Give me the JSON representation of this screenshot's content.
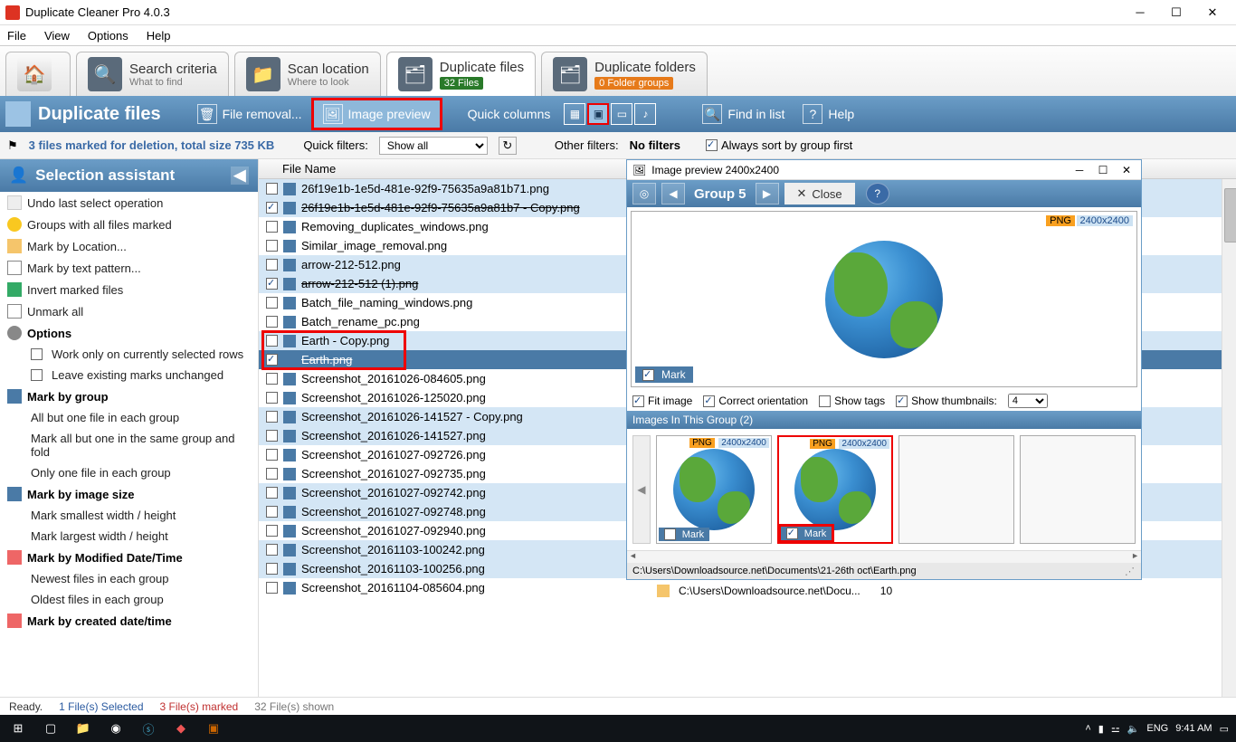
{
  "titlebar": {
    "title": "Duplicate Cleaner Pro 4.0.3"
  },
  "menubar": [
    "File",
    "View",
    "Options",
    "Help"
  ],
  "tabs": {
    "home": "",
    "search": {
      "title": "Search criteria",
      "sub": "What to find"
    },
    "scan": {
      "title": "Scan location",
      "sub": "Where to look"
    },
    "dup_files": {
      "title": "Duplicate files",
      "badge": "32 Files"
    },
    "dup_folders": {
      "title": "Duplicate folders",
      "badge": "0 Folder groups"
    }
  },
  "toolbar": {
    "header": "Duplicate files",
    "file_removal": "File removal...",
    "image_preview": "Image preview",
    "quick_columns": "Quick columns",
    "find_in_list": "Find in list",
    "help": "Help"
  },
  "filterbar": {
    "status": "3 files marked for deletion, total size 735 KB",
    "quick_label": "Quick filters:",
    "quick_value": "Show all",
    "other_label": "Other filters:",
    "other_value": "No filters",
    "always_sort": "Always sort by group first"
  },
  "sidebar": {
    "title": "Selection assistant",
    "items": [
      {
        "ic": "ic-undo",
        "t": "Undo last select operation",
        "bold": false
      },
      {
        "ic": "ic-warn",
        "t": "Groups with all files marked",
        "bold": false
      },
      {
        "ic": "ic-folder",
        "t": "Mark by Location...",
        "bold": false
      },
      {
        "ic": "ic-ab",
        "t": "Mark by text pattern...",
        "bold": false
      },
      {
        "ic": "ic-invert",
        "t": "Invert marked files",
        "bold": false
      },
      {
        "ic": "ic-unmark",
        "t": "Unmark all",
        "bold": false
      },
      {
        "ic": "ic-gear",
        "t": "Options",
        "bold": true
      },
      {
        "sub": true,
        "chk": false,
        "t": "Work only on currently selected rows"
      },
      {
        "sub": true,
        "chk": false,
        "t": "Leave existing marks unchanged"
      },
      {
        "ic": "ic-group",
        "t": "Mark by group",
        "bold": true
      },
      {
        "sub": true,
        "t": "All but one file in each group"
      },
      {
        "sub": true,
        "t": "Mark all but one in the same group and fold"
      },
      {
        "sub": true,
        "t": "Only one file in each group"
      },
      {
        "ic": "ic-image",
        "t": "Mark by image size",
        "bold": true
      },
      {
        "sub": true,
        "t": "Mark smallest width / height"
      },
      {
        "sub": true,
        "t": "Mark largest width / height"
      },
      {
        "ic": "ic-date",
        "t": "Mark by Modified Date/Time",
        "bold": true
      },
      {
        "sub": true,
        "t": "Newest files in each group"
      },
      {
        "sub": true,
        "t": "Oldest files in each group"
      },
      {
        "ic": "ic-date",
        "t": "Mark by created date/time",
        "bold": true
      }
    ]
  },
  "columns": {
    "filename": "File Name"
  },
  "files": [
    {
      "g": 1,
      "chk": false,
      "n": "26f19e1b-1e5d-481e-92f9-75635a9a81b71.png"
    },
    {
      "g": 1,
      "chk": true,
      "strike": true,
      "n": "26f19e1b-1e5d-481e-92f9-75635a9a81b7 - Copy.png"
    },
    {
      "g": 0,
      "chk": false,
      "n": "Removing_duplicates_windows.png"
    },
    {
      "g": 0,
      "chk": false,
      "n": "Similar_image_removal.png"
    },
    {
      "g": 1,
      "chk": false,
      "n": "arrow-212-512.png"
    },
    {
      "g": 1,
      "chk": true,
      "strike": true,
      "n": "arrow-212-512 (1).png"
    },
    {
      "g": 0,
      "chk": false,
      "n": "Batch_file_naming_windows.png"
    },
    {
      "g": 0,
      "chk": false,
      "n": "Batch_rename_pc.png"
    },
    {
      "g": 1,
      "chk": false,
      "n": "Earth - Copy.png",
      "hl": true
    },
    {
      "g": 1,
      "chk": true,
      "strike": true,
      "n": "Earth.png",
      "sel": true,
      "hl": true
    },
    {
      "g": 0,
      "chk": false,
      "n": "Screenshot_20161026-084605.png"
    },
    {
      "g": 0,
      "chk": false,
      "n": "Screenshot_20161026-125020.png"
    },
    {
      "g": 1,
      "chk": false,
      "n": "Screenshot_20161026-141527 - Copy.png"
    },
    {
      "g": 1,
      "chk": false,
      "n": "Screenshot_20161026-141527.png"
    },
    {
      "g": 0,
      "chk": false,
      "n": "Screenshot_20161027-092726.png"
    },
    {
      "g": 0,
      "chk": false,
      "n": "Screenshot_20161027-092735.png"
    },
    {
      "g": 1,
      "chk": false,
      "n": "Screenshot_20161027-092742.png"
    },
    {
      "g": 1,
      "chk": false,
      "n": "Screenshot_20161027-092748.png"
    },
    {
      "g": 0,
      "chk": false,
      "n": "Screenshot_20161027-092940.png"
    },
    {
      "g": 1,
      "chk": false,
      "n": "Screenshot_20161103-100242.png"
    },
    {
      "g": 1,
      "chk": false,
      "n": "Screenshot_20161103-100256.png"
    },
    {
      "g": 0,
      "chk": false,
      "n": "Screenshot_20161104-085604.png"
    }
  ],
  "preview": {
    "title": "Image preview 2400x2400",
    "group": "Group 5",
    "close": "Close",
    "png": "PNG",
    "dim": "2400x2400",
    "mark": "Mark",
    "fit": "Fit image",
    "orient": "Correct orientation",
    "showtags": "Show tags",
    "showthumbs": "Show thumbnails:",
    "thumbcount": "4",
    "group_hdr": "Images In This Group (2)",
    "path": "C:\\Users\\Downloadsource.net\\Documents\\21-26th oct\\Earth.png"
  },
  "bottom": {
    "folder": "C:\\Users\\Downloadsource.net\\Docu...",
    "count": "10"
  },
  "statusbar": {
    "ready": "Ready.",
    "selected": "1 File(s) Selected",
    "marked": "3 File(s) marked",
    "shown": "32 File(s) shown"
  },
  "taskbar": {
    "lang": "ENG",
    "time": "9:41 AM"
  }
}
